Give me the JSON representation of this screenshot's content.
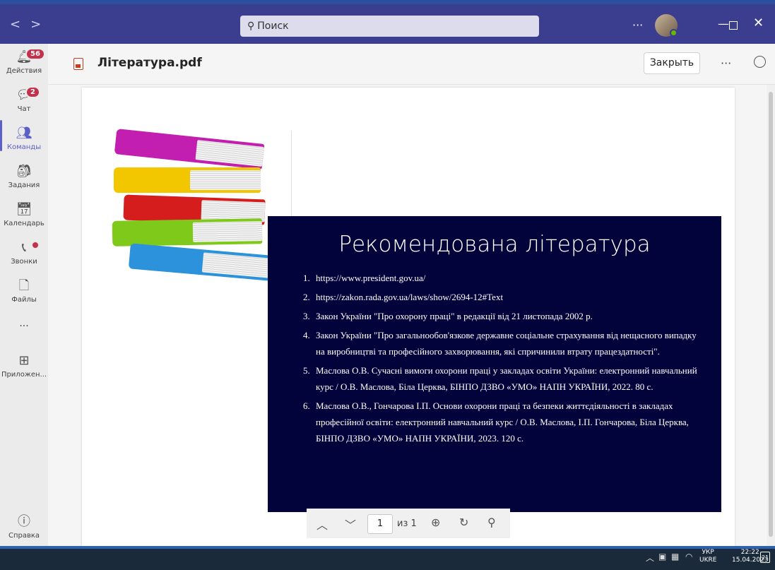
{
  "titlebar": {
    "back_label": "<",
    "forward_label": ">",
    "search_placeholder": "Поиск",
    "more_label": "···"
  },
  "rail": {
    "items": [
      {
        "label": "Действия",
        "badge": "56"
      },
      {
        "label": "Чат",
        "badge": "2"
      },
      {
        "label": "Команды"
      },
      {
        "label": "Задания"
      },
      {
        "label": "Календарь"
      },
      {
        "label": "Звонки"
      },
      {
        "label": "Файлы"
      },
      {
        "label": "···"
      },
      {
        "label": "Приложен..."
      },
      {
        "label": "Справка"
      }
    ]
  },
  "header": {
    "file_title": "Література.pdf",
    "close_label": "Закрыть",
    "more_label": "···"
  },
  "slide": {
    "title": "Рекомендована література",
    "references": [
      {
        "num": "1.",
        "text": "https://www.president.gov.ua/"
      },
      {
        "num": "2.",
        "text": "https://zakon.rada.gov.ua/laws/show/2694-12#Text"
      },
      {
        "num": "3.",
        "text": "Закон України \"Про охорону праці\" в редакції  від 21 листопада 2002 р."
      },
      {
        "num": "4.",
        "text": "Закон України \"Про загальнообов'язкове державне соціальне страхування  від нещасного випадку на виробництві  та професійного захворювання, які спричинили  втрату працездатності\"."
      },
      {
        "num": "5.",
        "text": "Маслова О.В. Сучасні вимоги охорони праці  у закладах освіти України: електронний навчальний  курс / О.В. Маслова, Біла Церква, БІНПО ДЗВО «УМО» НАПН УКРАЇНИ, 2022. 80 с."
      },
      {
        "num": "6.",
        "text": "Маслова О.В., Гончарова І.П. Основи охорони праці та безпеки життєдіяльності в закладах професійної освіти: електронний навчальний курс / О.В. Маслова, І.П. Гончарова, Біла Церква, БІНПО ДЗВО «УМО» НАПН УКРАЇНИ, 2023. 120 с."
      }
    ]
  },
  "pdf_toolbar": {
    "page_value": "1",
    "page_of": "из 1"
  },
  "taskbar": {
    "lang_top": "УКР",
    "lang_bottom": "UKRE",
    "time": "22:22",
    "date": "15.04.2023",
    "notif_count": "21"
  },
  "colors": {
    "titlebar": "#3b3d8f",
    "accent": "#5b5fc7",
    "slide_bg": "#03033b",
    "badge": "#c4314b"
  }
}
